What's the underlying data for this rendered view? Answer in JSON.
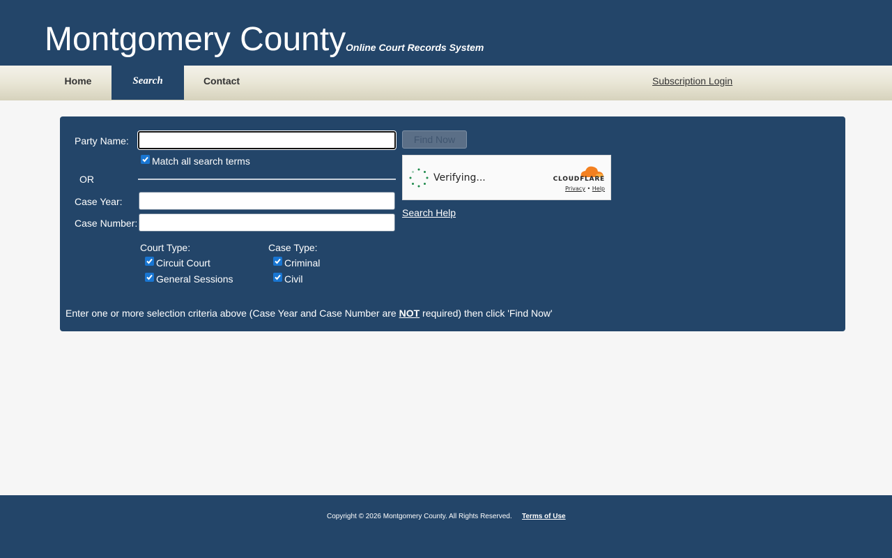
{
  "header": {
    "title": "Montgomery County",
    "subtitle": "Online Court Records System"
  },
  "nav": {
    "items": [
      {
        "label": "Home"
      },
      {
        "label": "Search",
        "active": true
      },
      {
        "label": "Contact"
      }
    ],
    "login_label": "Subscription Login"
  },
  "form": {
    "party_name_label": "Party Name:",
    "party_name_value": "",
    "match_all_label": "Match all search terms",
    "match_all_checked": true,
    "or_label": "OR",
    "case_year_label": "Case Year:",
    "case_year_value": "",
    "case_number_label": "Case Number:",
    "case_number_value": "",
    "find_button_label": "Find Now",
    "search_help_label": "Search Help",
    "court_type_label": "Court Type:",
    "court_types": [
      {
        "label": "Circuit Court",
        "checked": true
      },
      {
        "label": "General Sessions",
        "checked": true
      }
    ],
    "case_type_label": "Case Type:",
    "case_types": [
      {
        "label": "Criminal",
        "checked": true
      },
      {
        "label": "Civil",
        "checked": true
      }
    ],
    "instruction_prefix": "Enter one or more selection criteria above (Case Year and Case Number are ",
    "instruction_emphasis": "NOT",
    "instruction_suffix": " required) then click 'Find Now'"
  },
  "captcha": {
    "status": "Verifying...",
    "brand": "CLOUDFLARE",
    "privacy_label": "Privacy",
    "separator": "•",
    "help_label": "Help",
    "cloud_color": "#f38020"
  },
  "footer": {
    "copyright": "Copyright © 2026 Montgomery County. All Rights Reserved.",
    "terms_label": "Terms of Use"
  },
  "colors": {
    "primary": "#234569",
    "checkbox": "#1976d2"
  }
}
